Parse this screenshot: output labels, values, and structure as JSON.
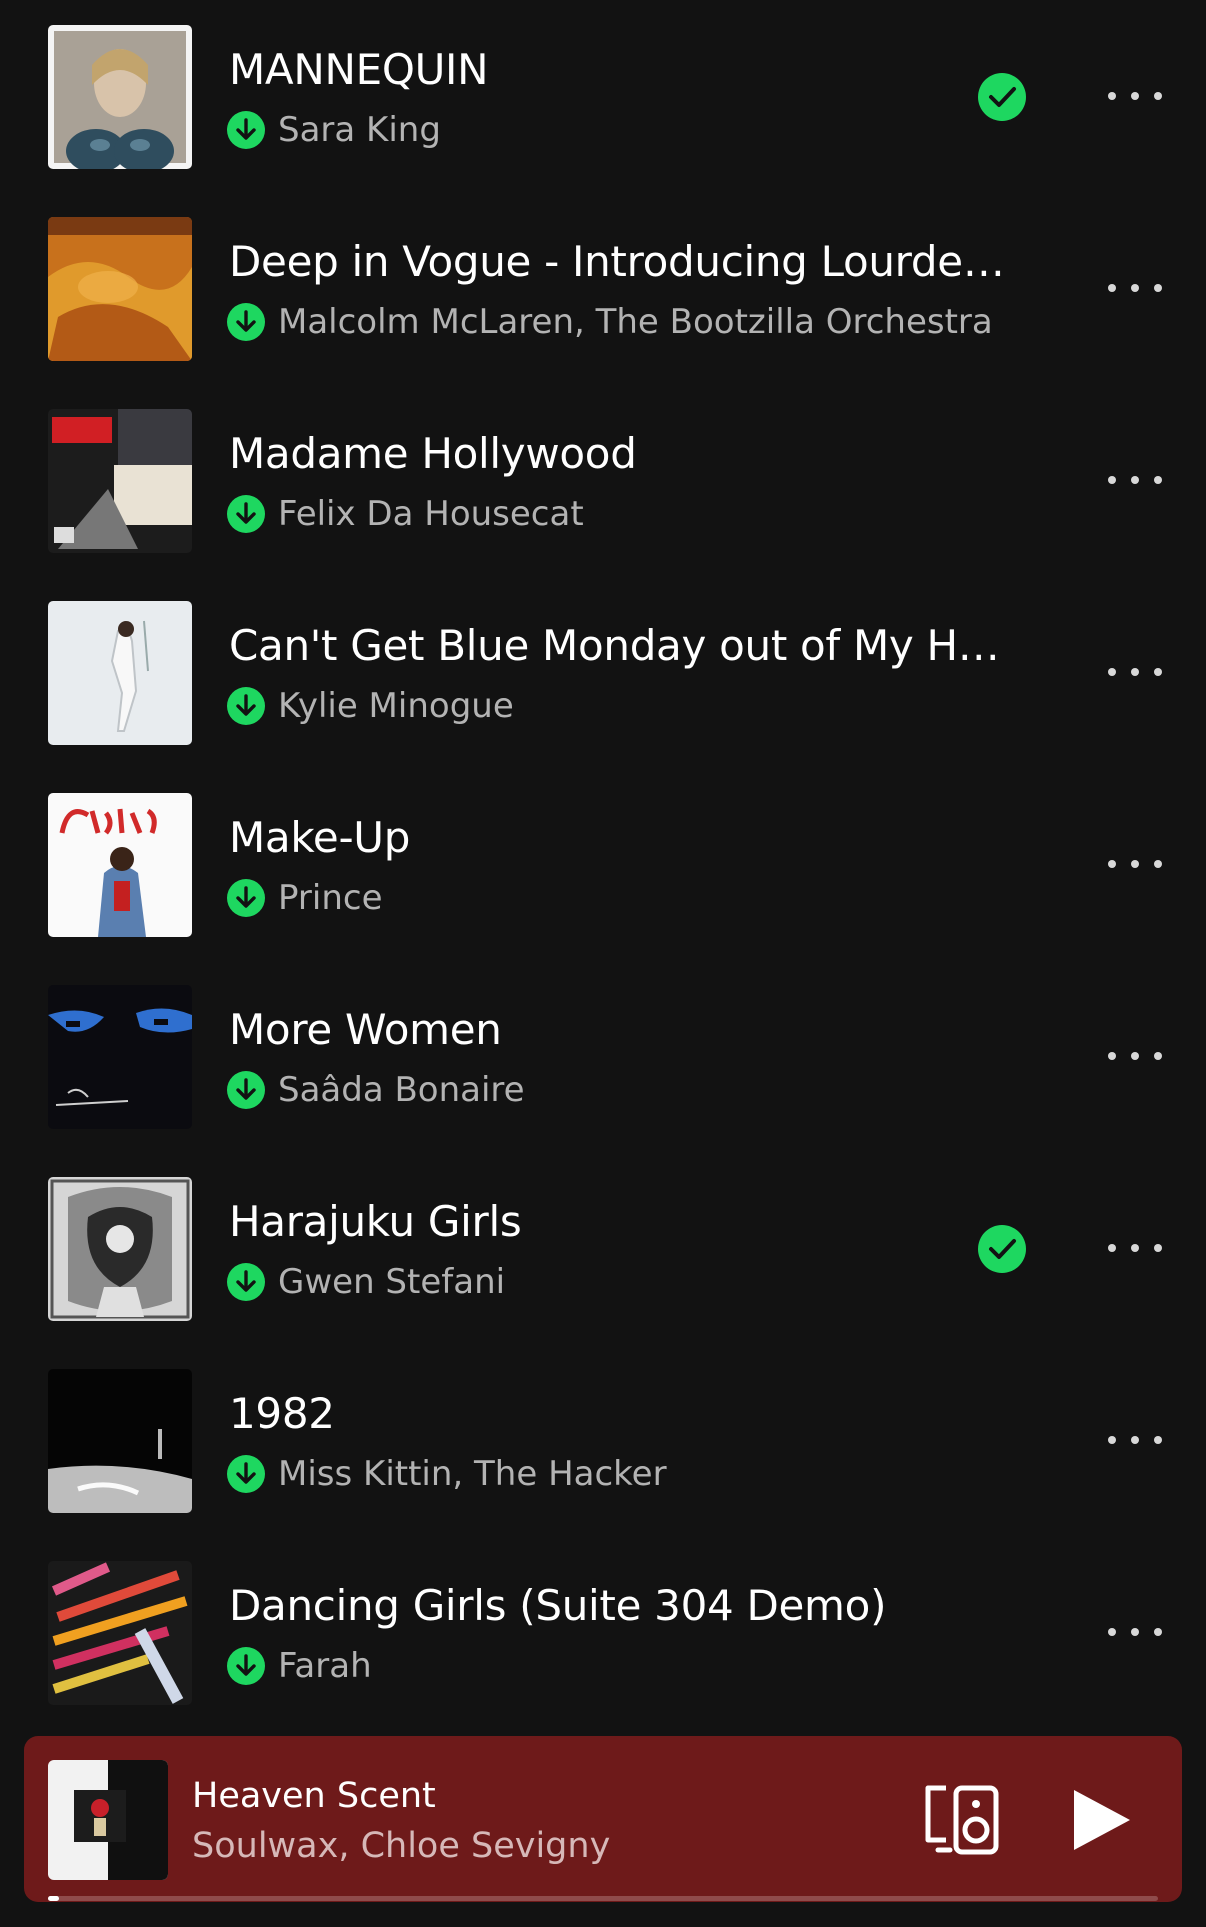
{
  "tracks": [
    {
      "title": "MANNEQUIN",
      "artist": "Sara King",
      "downloaded": true,
      "liked": true,
      "cover": "pearl-portrait"
    },
    {
      "title": "Deep in Vogue - Introducing Lourdes...",
      "artist": "Malcolm McLaren, The Bootzilla Orchestra",
      "downloaded": true,
      "liked": false,
      "cover": "orange-painting"
    },
    {
      "title": "Madame Hollywood",
      "artist": "Felix Da Housecat",
      "downloaded": true,
      "liked": false,
      "cover": "felix-magazine"
    },
    {
      "title": "Can't Get Blue Monday out of My Head",
      "artist": "Kylie Minogue",
      "downloaded": true,
      "liked": false,
      "cover": "white-figure"
    },
    {
      "title": "Make-Up",
      "artist": "Prince",
      "downloaded": true,
      "liked": false,
      "cover": "prince-originals"
    },
    {
      "title": "More Women",
      "artist": "Saâda Bonaire",
      "downloaded": true,
      "liked": false,
      "cover": "blue-faces"
    },
    {
      "title": "Harajuku Girls",
      "artist": "Gwen Stefani",
      "downloaded": true,
      "liked": true,
      "cover": "ornate-bw"
    },
    {
      "title": "1982",
      "artist": "Miss Kittin, The Hacker",
      "downloaded": true,
      "liked": false,
      "cover": "dark-bw-floor"
    },
    {
      "title": "Dancing Girls (Suite 304 Demo)",
      "artist": "Farah",
      "downloaded": true,
      "liked": false,
      "cover": "colorful-typography"
    }
  ],
  "mini_player": {
    "title": "Heaven Scent",
    "artist": "Soulwax, Chloe Sevigny",
    "progress": 0.01,
    "device_icon": "connect-device-icon",
    "play_icon": "play-icon"
  },
  "colors": {
    "background": "#121212",
    "accent": "#1ed760",
    "player_bg": "#6e1a1a"
  }
}
